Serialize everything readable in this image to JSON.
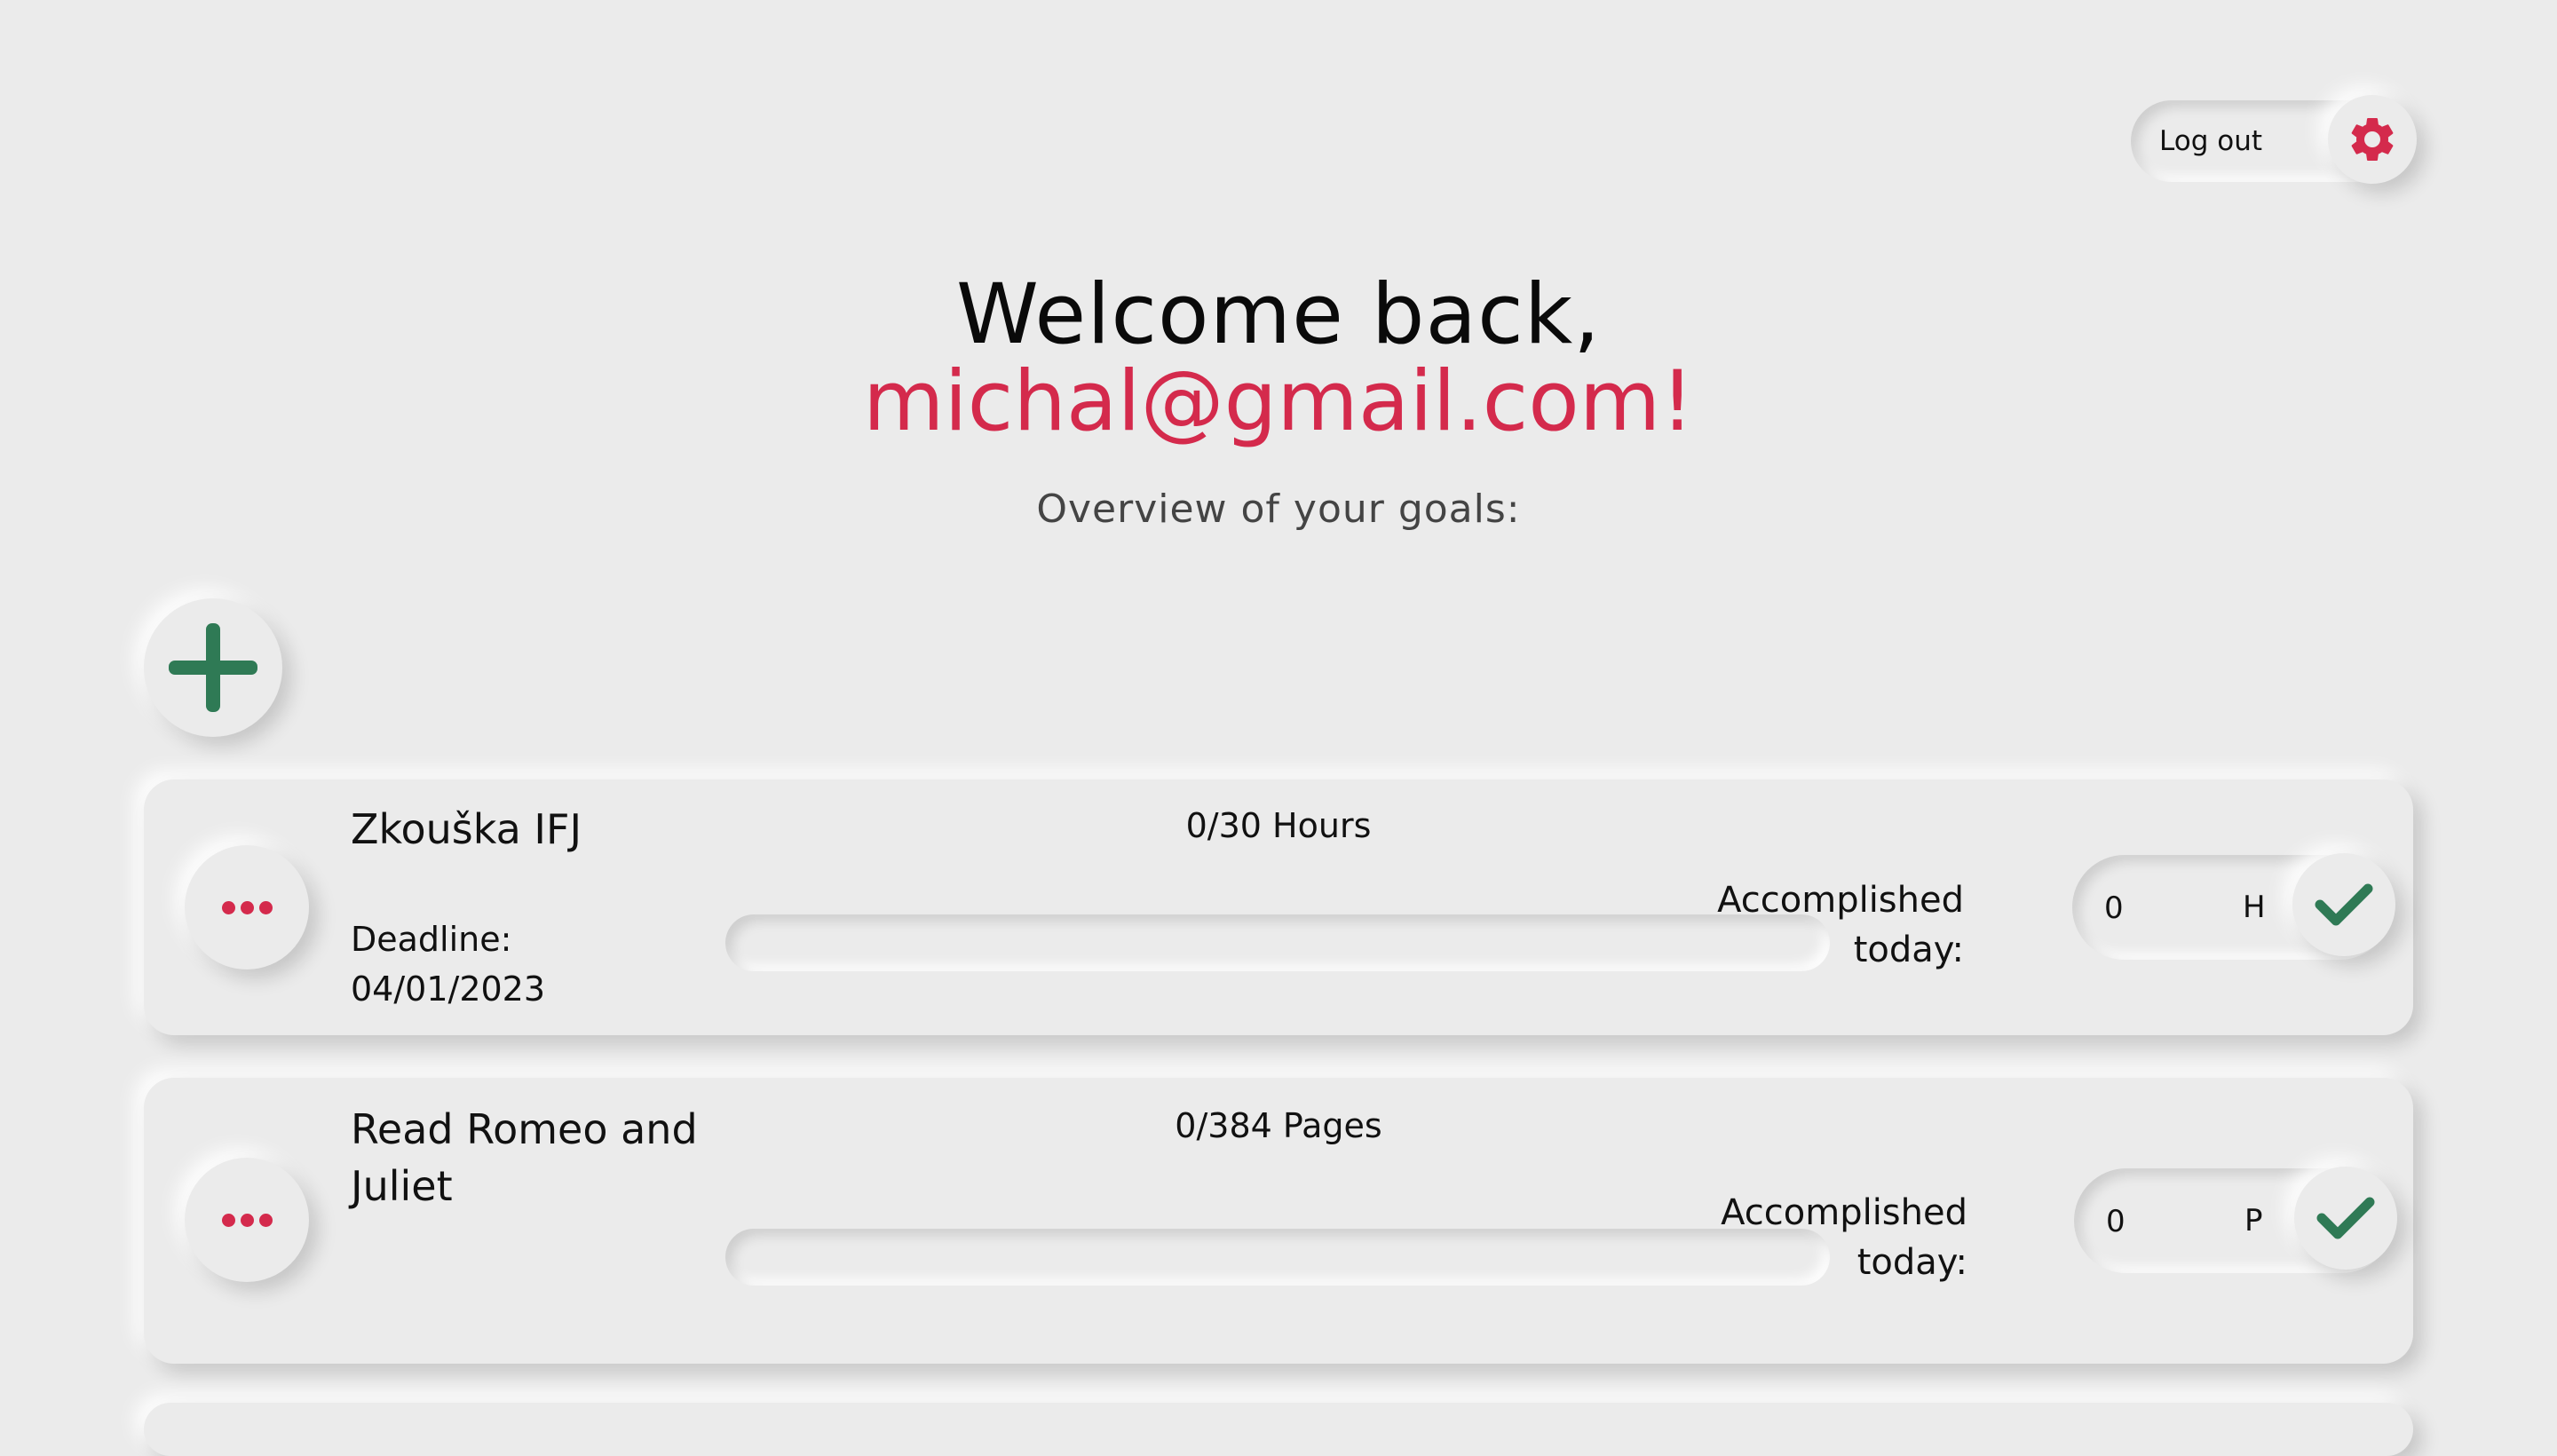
{
  "header": {
    "logout_label": "Log out",
    "settings_icon": "gear-icon"
  },
  "welcome": {
    "greeting": "Welcome back,",
    "email": "michal@gmail.com!",
    "overview": "Overview of your goals:"
  },
  "colors": {
    "accent": "#d42a4c",
    "success": "#2f7a55",
    "background": "#ebebeb"
  },
  "add_goal_icon": "plus-icon",
  "goals": [
    {
      "title": "Zkouška IFJ",
      "deadline_label": "Deadline:",
      "deadline": "04/01/2023",
      "progress": "0/30 Hours",
      "progress_fraction": 0,
      "accomplished_line1": "Accomplished",
      "accomplished_line2": "today:",
      "amount": "0",
      "unit": "H"
    },
    {
      "title": "Read Romeo and Juliet",
      "progress": "0/384 Pages",
      "progress_fraction": 0,
      "accomplished_line1": "Accomplished",
      "accomplished_line2": "today:",
      "amount": "0",
      "unit": "P"
    }
  ]
}
